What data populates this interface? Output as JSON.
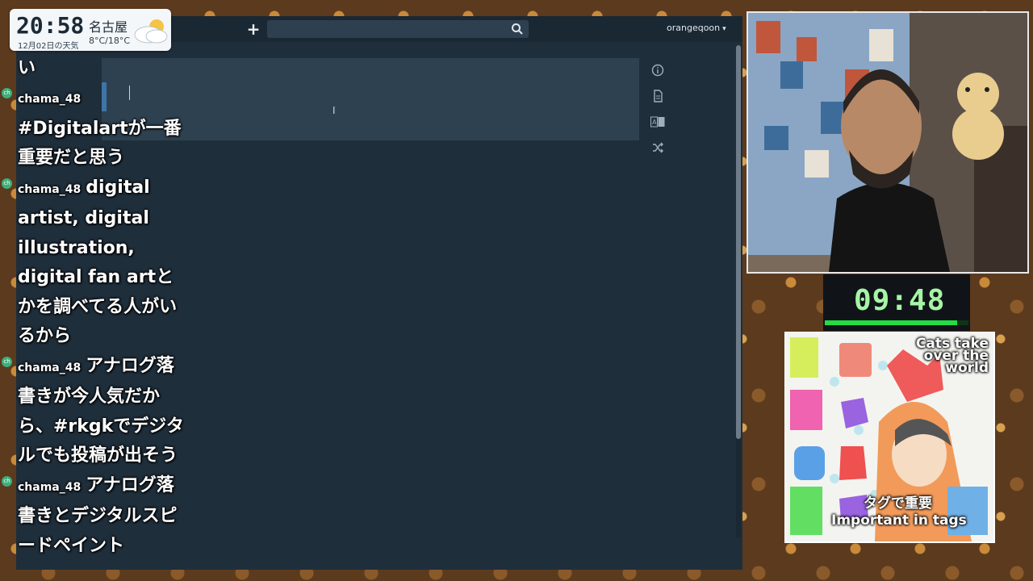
{
  "toolbar": {
    "add_tab": "+",
    "search_placeholder": "",
    "user_name": "orangeqoon",
    "user_menu_icon": "chevron-down-icon"
  },
  "editor": {
    "content": "",
    "side_tools": [
      "info-icon",
      "document-icon",
      "translate-icon",
      "shuffle-icon"
    ]
  },
  "clock": {
    "time": "20:58",
    "date": "12月02日の天気",
    "city": "名古屋",
    "temp": "8°C/18°C",
    "weather": "cloudy-sun-icon"
  },
  "chat": {
    "top_partial": "い",
    "messages": [
      {
        "user": "chama_48",
        "text": "#Digitalartが一番重要だと思う"
      },
      {
        "user": "chama_48",
        "text": "digital artist, digital illustration, digital fan artとかを調べてる人がいるから"
      },
      {
        "user": "chama_48",
        "text": "アナログ落書きが今人気だから、#rkgkでデジタルでも投稿が出そう"
      },
      {
        "user": "chama_48",
        "text": "アナログ落書きとデジタルスピードペイント"
      }
    ]
  },
  "timer": {
    "display": "09:48",
    "progress": 0.92
  },
  "art_card": {
    "title": "Cats take over the world",
    "tag_jp": "タグで重要",
    "tag_en": "Important in tags"
  },
  "colors": {
    "app_bg": "#1f2e3b",
    "toolbar_bg": "#1a2834",
    "editor_bg": "#2e4150",
    "accent": "#3f74a8",
    "timer_green": "#22dd44"
  }
}
